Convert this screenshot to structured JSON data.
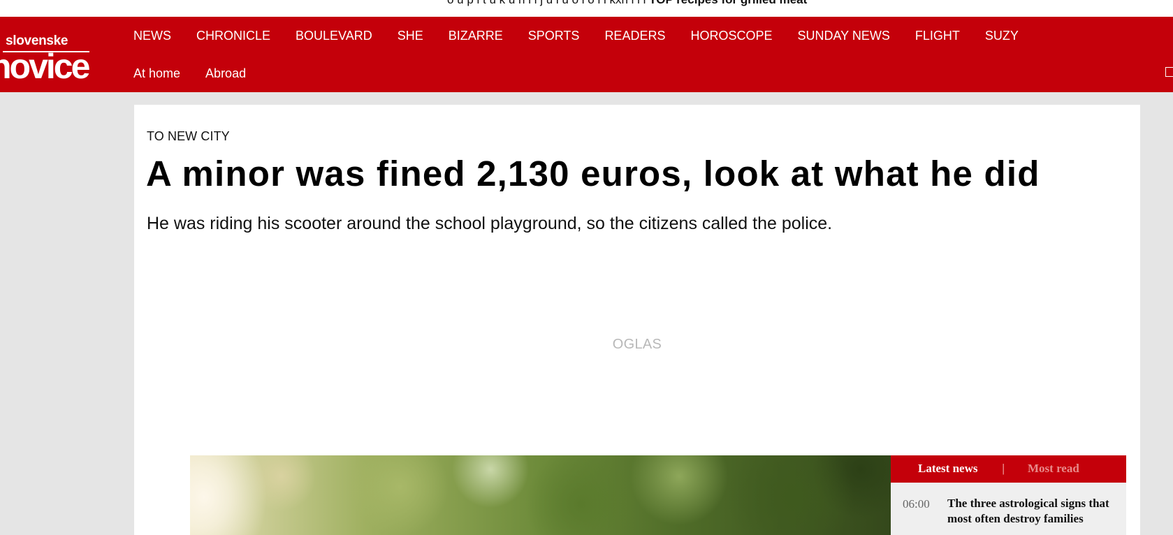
{
  "topbar": {
    "ticker_text": "o u p i t u k u h i i j u i u o i o i i kxh i i i",
    "ticker_bold": "TOP recipes for grilled meat"
  },
  "logo": {
    "line1": "slovenske",
    "line2": "novice"
  },
  "nav": {
    "row1": [
      "NEWS",
      "CHRONICLE",
      "BOULEVARD",
      "SHE",
      "BIZARRE",
      "SPORTS",
      "READERS",
      "HOROSCOPE",
      "SUNDAY NEWS",
      "FLIGHT",
      "SUZY"
    ],
    "row2": [
      "At home",
      "Abroad"
    ]
  },
  "article": {
    "kicker": "TO NEW CITY",
    "headline": "A minor was fined 2,130 euros, look at what he did",
    "lead": "He was riding his scooter around the school playground, so the citizens called the police.",
    "ad_label": "OGLAS"
  },
  "sidebar": {
    "tab_active": "Latest news",
    "tab_separator": "|",
    "tab_inactive": "Most read",
    "items": [
      {
        "time": "06:00",
        "title": "The three astrological signs that most often destroy families"
      }
    ]
  },
  "colors": {
    "brand_red": "#c4000a",
    "page_bg": "#e5e5e5"
  }
}
